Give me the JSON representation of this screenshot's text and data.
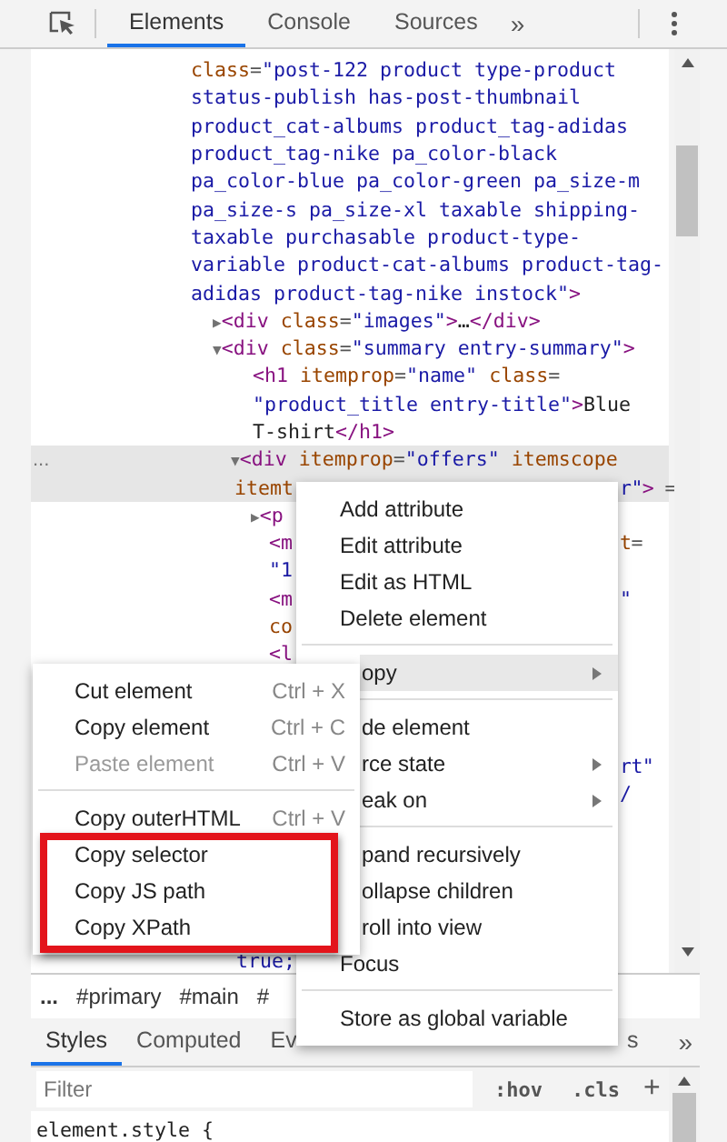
{
  "toolbar": {
    "tabs": [
      {
        "label": "Elements",
        "selected": true
      },
      {
        "label": "Console",
        "selected": false
      },
      {
        "label": "Sources",
        "selected": false
      }
    ],
    "overflow": "»"
  },
  "elements_tree": {
    "lines": [
      {
        "kind": "code",
        "selected": false,
        "parts": [
          {
            "kind": "attr",
            "text": "class"
          },
          {
            "kind": "punct",
            "text": "="
          },
          {
            "kind": "val",
            "text": "\"post-122 product type-product"
          }
        ]
      },
      {
        "kind": "code",
        "selected": false,
        "parts": [
          {
            "kind": "val",
            "text": "status-publish has-post-thumbnail"
          }
        ]
      },
      {
        "kind": "code",
        "selected": false,
        "parts": [
          {
            "kind": "val",
            "text": "product_cat-albums product_tag-adidas"
          }
        ]
      },
      {
        "kind": "code",
        "selected": false,
        "parts": [
          {
            "kind": "val",
            "text": "product_tag-nike pa_color-black"
          }
        ]
      },
      {
        "kind": "code",
        "selected": false,
        "parts": [
          {
            "kind": "val",
            "text": "pa_color-blue pa_color-green pa_size-m"
          }
        ]
      },
      {
        "kind": "code",
        "selected": false,
        "parts": [
          {
            "kind": "val",
            "text": "pa_size-s pa_size-xl taxable shipping-"
          }
        ]
      },
      {
        "kind": "code",
        "selected": false,
        "parts": [
          {
            "kind": "val",
            "text": "taxable purchasable product-type-"
          }
        ]
      },
      {
        "kind": "code",
        "selected": false,
        "parts": [
          {
            "kind": "val",
            "text": "variable product-cat-albums product-tag-"
          }
        ]
      },
      {
        "kind": "code",
        "selected": false,
        "parts": [
          {
            "kind": "val",
            "text": "adidas product-tag-nike instock\""
          },
          {
            "kind": "tag",
            "text": ">"
          }
        ]
      },
      {
        "kind": "code",
        "selected": false,
        "parts": [
          {
            "kind": "arrow",
            "text": "▶"
          },
          {
            "kind": "tag",
            "text": "<div"
          },
          {
            "kind": "attr",
            "text": " class"
          },
          {
            "kind": "punct",
            "text": "="
          },
          {
            "kind": "val",
            "text": "\"images\""
          },
          {
            "kind": "tag",
            "text": ">"
          },
          {
            "kind": "text",
            "text": "…"
          },
          {
            "kind": "tag",
            "text": "</div>"
          }
        ]
      },
      {
        "kind": "code",
        "selected": false,
        "parts": [
          {
            "kind": "arrow",
            "text": "▼"
          },
          {
            "kind": "tag",
            "text": "<div"
          },
          {
            "kind": "attr",
            "text": " class"
          },
          {
            "kind": "punct",
            "text": "="
          },
          {
            "kind": "val",
            "text": "\"summary entry-summary\""
          },
          {
            "kind": "tag",
            "text": ">"
          }
        ]
      },
      {
        "kind": "code",
        "selected": false,
        "parts": [
          {
            "kind": "tag",
            "text": "<h1"
          },
          {
            "kind": "attr",
            "text": " itemprop"
          },
          {
            "kind": "punct",
            "text": "="
          },
          {
            "kind": "val",
            "text": "\"name\""
          },
          {
            "kind": "attr",
            "text": " class"
          },
          {
            "kind": "punct",
            "text": "="
          }
        ]
      },
      {
        "kind": "code",
        "selected": false,
        "parts": [
          {
            "kind": "val",
            "text": "\"product_title entry-title\""
          },
          {
            "kind": "tag",
            "text": ">"
          },
          {
            "kind": "text",
            "text": "Blue"
          }
        ]
      },
      {
        "kind": "code",
        "selected": false,
        "parts": [
          {
            "kind": "text",
            "text": "T-shirt"
          },
          {
            "kind": "tag",
            "text": "</h1>"
          }
        ]
      },
      {
        "kind": "code",
        "selected": true,
        "gutter": "...",
        "parts": [
          {
            "kind": "arrow",
            "text": "▼"
          },
          {
            "kind": "tag",
            "text": "<div"
          },
          {
            "kind": "attr",
            "text": " itemprop"
          },
          {
            "kind": "punct",
            "text": "="
          },
          {
            "kind": "val",
            "text": "\"offers\""
          },
          {
            "kind": "attr",
            "text": " itemscope"
          }
        ]
      },
      {
        "kind": "code",
        "selected": true,
        "parts": [
          {
            "kind": "attr",
            "text": "itemt"
          }
        ],
        "tail": [
          {
            "kind": "val",
            "text": "r\""
          },
          {
            "kind": "tag",
            "text": ">"
          },
          {
            "kind": "punct",
            "text": " ="
          }
        ]
      },
      {
        "kind": "code",
        "selected": false,
        "parts": [
          {
            "kind": "arrow",
            "text": "▶"
          },
          {
            "kind": "tag",
            "text": "<p"
          }
        ]
      },
      {
        "kind": "code",
        "selected": false,
        "parts": [
          {
            "kind": "tag",
            "text": "<m"
          }
        ],
        "tail": [
          {
            "kind": "attr",
            "text": "t"
          },
          {
            "kind": "punct",
            "text": "="
          }
        ]
      },
      {
        "kind": "code",
        "selected": false,
        "parts": [
          {
            "kind": "val",
            "text": "\"1"
          }
        ]
      },
      {
        "kind": "code",
        "selected": false,
        "parts": [
          {
            "kind": "tag",
            "text": "<m"
          }
        ],
        "tail": [
          {
            "kind": "val",
            "text": "\""
          }
        ]
      },
      {
        "kind": "code",
        "selected": false,
        "parts": [
          {
            "kind": "attr",
            "text": "co"
          }
        ]
      },
      {
        "kind": "code",
        "selected": false,
        "parts": [
          {
            "kind": "tag",
            "text": "<l"
          }
        ]
      },
      {
        "kind": "blank",
        "selected": false
      },
      {
        "kind": "blank",
        "selected": false
      },
      {
        "kind": "blank",
        "selected": false
      },
      {
        "kind": "code",
        "selected": false,
        "tail": [
          {
            "kind": "val",
            "text": "rt\""
          }
        ]
      },
      {
        "kind": "code",
        "selected": false,
        "tail": [
          {
            "kind": "val",
            "text": "/"
          }
        ]
      },
      {
        "kind": "blank",
        "selected": false
      },
      {
        "kind": "blank",
        "selected": false
      },
      {
        "kind": "blank",
        "selected": false
      },
      {
        "kind": "blank",
        "selected": false
      },
      {
        "kind": "blank",
        "selected": false
      },
      {
        "kind": "code",
        "selected": false,
        "parts": [
          {
            "kind": "val",
            "text": "true;"
          }
        ]
      }
    ]
  },
  "context_menu": {
    "items": [
      {
        "kind": "item",
        "label": "Add attribute",
        "highlighted": false,
        "has_submenu": false
      },
      {
        "kind": "item",
        "label": "Edit attribute",
        "highlighted": false,
        "has_submenu": false
      },
      {
        "kind": "item",
        "label": "Edit as HTML",
        "highlighted": false,
        "has_submenu": false
      },
      {
        "kind": "item",
        "label": "Delete element",
        "highlighted": false,
        "has_submenu": false
      },
      {
        "kind": "separator"
      },
      {
        "kind": "partial",
        "label": "opy",
        "highlighted": true,
        "has_submenu": true
      },
      {
        "kind": "separator"
      },
      {
        "kind": "partial",
        "label": "de element",
        "highlighted": false,
        "has_submenu": false
      },
      {
        "kind": "partial",
        "label": "rce state",
        "highlighted": false,
        "has_submenu": true
      },
      {
        "kind": "partial",
        "label": "eak on",
        "highlighted": false,
        "has_submenu": true
      },
      {
        "kind": "separator"
      },
      {
        "kind": "partial",
        "label": "pand recursively",
        "highlighted": false,
        "has_submenu": false
      },
      {
        "kind": "partial",
        "label": "ollapse children",
        "highlighted": false,
        "has_submenu": false
      },
      {
        "kind": "partial",
        "label": "roll into view",
        "highlighted": false,
        "has_submenu": false
      },
      {
        "kind": "item",
        "label": "Focus",
        "highlighted": false,
        "has_submenu": false
      },
      {
        "kind": "separator"
      },
      {
        "kind": "item",
        "label": "Store as global variable",
        "highlighted": false,
        "has_submenu": false
      }
    ]
  },
  "copy_submenu": {
    "items": [
      {
        "kind": "item",
        "label": "Cut element",
        "shortcut": "Ctrl + X",
        "disabled": false
      },
      {
        "kind": "item",
        "label": "Copy element",
        "shortcut": "Ctrl + C",
        "disabled": false
      },
      {
        "kind": "item",
        "label": "Paste element",
        "shortcut": "Ctrl + V",
        "disabled": true
      },
      {
        "kind": "separator"
      },
      {
        "kind": "item",
        "label": "Copy outerHTML",
        "shortcut": "Ctrl + V",
        "disabled": false
      },
      {
        "kind": "item",
        "label": "Copy selector",
        "disabled": false
      },
      {
        "kind": "item",
        "label": "Copy JS path",
        "disabled": false
      },
      {
        "kind": "item",
        "label": "Copy XPath",
        "disabled": false
      }
    ]
  },
  "breadcrumbs": [
    "...",
    "#primary",
    "#main",
    "#"
  ],
  "lower_tabs": {
    "tabs": [
      {
        "label": "Styles",
        "selected": true
      },
      {
        "label": "Computed",
        "selected": false
      },
      {
        "label": "Ev",
        "selected": false
      },
      {
        "label": "s",
        "selected": false
      }
    ],
    "overflow": "»"
  },
  "filter": {
    "placeholder": "Filter",
    "toggles": [
      ":hov",
      ".cls"
    ],
    "add": "+"
  },
  "styles_code": "element.style {"
}
